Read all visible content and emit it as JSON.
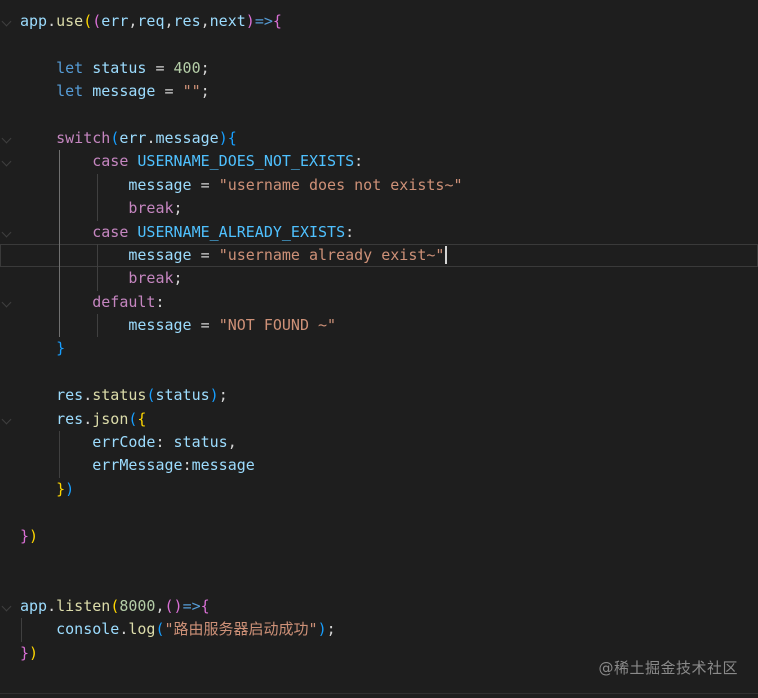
{
  "editor": {
    "lines": [
      {
        "fold": true,
        "guides": [],
        "tokens": [
          [
            "app",
            "var"
          ],
          [
            ".",
            "op"
          ],
          [
            "use",
            "fn"
          ],
          [
            "(",
            "p1"
          ],
          [
            "(",
            "p2"
          ],
          [
            "err",
            "var"
          ],
          [
            ",",
            "op"
          ],
          [
            "req",
            "var"
          ],
          [
            ",",
            "op"
          ],
          [
            "res",
            "var"
          ],
          [
            ",",
            "op"
          ],
          [
            "next",
            "var"
          ],
          [
            ")",
            "p2"
          ],
          [
            "=>",
            "decl"
          ],
          [
            "{",
            "p2"
          ]
        ]
      },
      {
        "guides": [],
        "tokens": []
      },
      {
        "guides": [],
        "tokens": [
          [
            "    ",
            "op"
          ],
          [
            "let",
            "decl"
          ],
          [
            " ",
            "op"
          ],
          [
            "status",
            "var"
          ],
          [
            " = ",
            "op"
          ],
          [
            "400",
            "num"
          ],
          [
            ";",
            "op"
          ]
        ]
      },
      {
        "guides": [],
        "tokens": [
          [
            "    ",
            "op"
          ],
          [
            "let",
            "decl"
          ],
          [
            " ",
            "op"
          ],
          [
            "message",
            "var"
          ],
          [
            " = ",
            "op"
          ],
          [
            "\"\"",
            "str"
          ],
          [
            ";",
            "op"
          ]
        ]
      },
      {
        "guides": [],
        "tokens": []
      },
      {
        "fold": true,
        "guides": [],
        "tokens": [
          [
            "    ",
            "op"
          ],
          [
            "switch",
            "kw"
          ],
          [
            "(",
            "p3"
          ],
          [
            "err",
            "var"
          ],
          [
            ".",
            "op"
          ],
          [
            "message",
            "var"
          ],
          [
            ")",
            "p3"
          ],
          [
            "{",
            "p3"
          ]
        ]
      },
      {
        "fold": true,
        "guides": [
          {
            "col": 4,
            "active": true
          }
        ],
        "tokens": [
          [
            "        ",
            "op"
          ],
          [
            "case",
            "kw"
          ],
          [
            " ",
            "op"
          ],
          [
            "USERNAME_DOES_NOT_EXISTS",
            "const"
          ],
          [
            ":",
            "op"
          ]
        ]
      },
      {
        "guides": [
          {
            "col": 4,
            "active": true
          },
          {
            "col": 8
          }
        ],
        "tokens": [
          [
            "            ",
            "op"
          ],
          [
            "message",
            "var"
          ],
          [
            " = ",
            "op"
          ],
          [
            "\"username does not exists~\"",
            "str"
          ]
        ]
      },
      {
        "guides": [
          {
            "col": 4,
            "active": true
          },
          {
            "col": 8
          }
        ],
        "tokens": [
          [
            "            ",
            "op"
          ],
          [
            "break",
            "kw"
          ],
          [
            ";",
            "op"
          ]
        ]
      },
      {
        "fold": true,
        "guides": [
          {
            "col": 4,
            "active": true
          }
        ],
        "tokens": [
          [
            "        ",
            "op"
          ],
          [
            "case",
            "kw"
          ],
          [
            " ",
            "op"
          ],
          [
            "USERNAME_ALREADY_EXISTS",
            "const"
          ],
          [
            ":",
            "op"
          ]
        ]
      },
      {
        "current": true,
        "cursor": true,
        "guides": [
          {
            "col": 4,
            "active": true
          },
          {
            "col": 8
          }
        ],
        "tokens": [
          [
            "            ",
            "op"
          ],
          [
            "message",
            "var"
          ],
          [
            " = ",
            "op"
          ],
          [
            "\"username already exist~\"",
            "str"
          ]
        ]
      },
      {
        "guides": [
          {
            "col": 4,
            "active": true
          },
          {
            "col": 8
          }
        ],
        "tokens": [
          [
            "            ",
            "op"
          ],
          [
            "break",
            "kw"
          ],
          [
            ";",
            "op"
          ]
        ]
      },
      {
        "fold": true,
        "guides": [
          {
            "col": 4,
            "active": true
          }
        ],
        "tokens": [
          [
            "        ",
            "op"
          ],
          [
            "default",
            "kw"
          ],
          [
            ":",
            "op"
          ]
        ]
      },
      {
        "guides": [
          {
            "col": 4,
            "active": true
          },
          {
            "col": 8
          }
        ],
        "tokens": [
          [
            "            ",
            "op"
          ],
          [
            "message",
            "var"
          ],
          [
            " = ",
            "op"
          ],
          [
            "\"NOT FOUND ~\"",
            "str"
          ]
        ]
      },
      {
        "guides": [],
        "tokens": [
          [
            "    ",
            "op"
          ],
          [
            "}",
            "p3"
          ]
        ]
      },
      {
        "guides": [],
        "tokens": []
      },
      {
        "guides": [],
        "tokens": [
          [
            "    ",
            "op"
          ],
          [
            "res",
            "var"
          ],
          [
            ".",
            "op"
          ],
          [
            "status",
            "fn"
          ],
          [
            "(",
            "p3"
          ],
          [
            "status",
            "var"
          ],
          [
            ")",
            "p3"
          ],
          [
            ";",
            "op"
          ]
        ]
      },
      {
        "fold": true,
        "guides": [],
        "tokens": [
          [
            "    ",
            "op"
          ],
          [
            "res",
            "var"
          ],
          [
            ".",
            "op"
          ],
          [
            "json",
            "fn"
          ],
          [
            "(",
            "p3"
          ],
          [
            "{",
            "p1"
          ]
        ]
      },
      {
        "guides": [
          {
            "col": 4
          }
        ],
        "tokens": [
          [
            "        ",
            "op"
          ],
          [
            "errCode",
            "var"
          ],
          [
            ": ",
            "op"
          ],
          [
            "status",
            "var"
          ],
          [
            ",",
            "op"
          ]
        ]
      },
      {
        "guides": [
          {
            "col": 4
          }
        ],
        "tokens": [
          [
            "        ",
            "op"
          ],
          [
            "errMessage",
            "var"
          ],
          [
            ":",
            "op"
          ],
          [
            "message",
            "var"
          ]
        ]
      },
      {
        "guides": [],
        "tokens": [
          [
            "    ",
            "op"
          ],
          [
            "}",
            "p1"
          ],
          [
            ")",
            "p3"
          ]
        ]
      },
      {
        "guides": [],
        "tokens": []
      },
      {
        "guides": [],
        "tokens": [
          [
            "}",
            "p2"
          ],
          [
            ")",
            "p1"
          ]
        ]
      },
      {
        "guides": [],
        "tokens": []
      },
      {
        "guides": [],
        "tokens": []
      },
      {
        "fold": true,
        "guides": [],
        "tokens": [
          [
            "app",
            "var"
          ],
          [
            ".",
            "op"
          ],
          [
            "listen",
            "fn"
          ],
          [
            "(",
            "p1"
          ],
          [
            "8000",
            "num"
          ],
          [
            ",",
            "op"
          ],
          [
            "(",
            "p2"
          ],
          [
            ")",
            "p2"
          ],
          [
            "=>",
            "decl"
          ],
          [
            "{",
            "p2"
          ]
        ]
      },
      {
        "guides": [
          {
            "col": 0
          }
        ],
        "tokens": [
          [
            "    ",
            "op"
          ],
          [
            "console",
            "var"
          ],
          [
            ".",
            "op"
          ],
          [
            "log",
            "fn"
          ],
          [
            "(",
            "p3"
          ],
          [
            "\"路由服务器启动成功\"",
            "str"
          ],
          [
            ")",
            "p3"
          ],
          [
            ";",
            "op"
          ]
        ]
      },
      {
        "guides": [],
        "tokens": [
          [
            "}",
            "p2"
          ],
          [
            ")",
            "p1"
          ]
        ]
      }
    ]
  },
  "watermark": "@稀土掘金技术社区"
}
